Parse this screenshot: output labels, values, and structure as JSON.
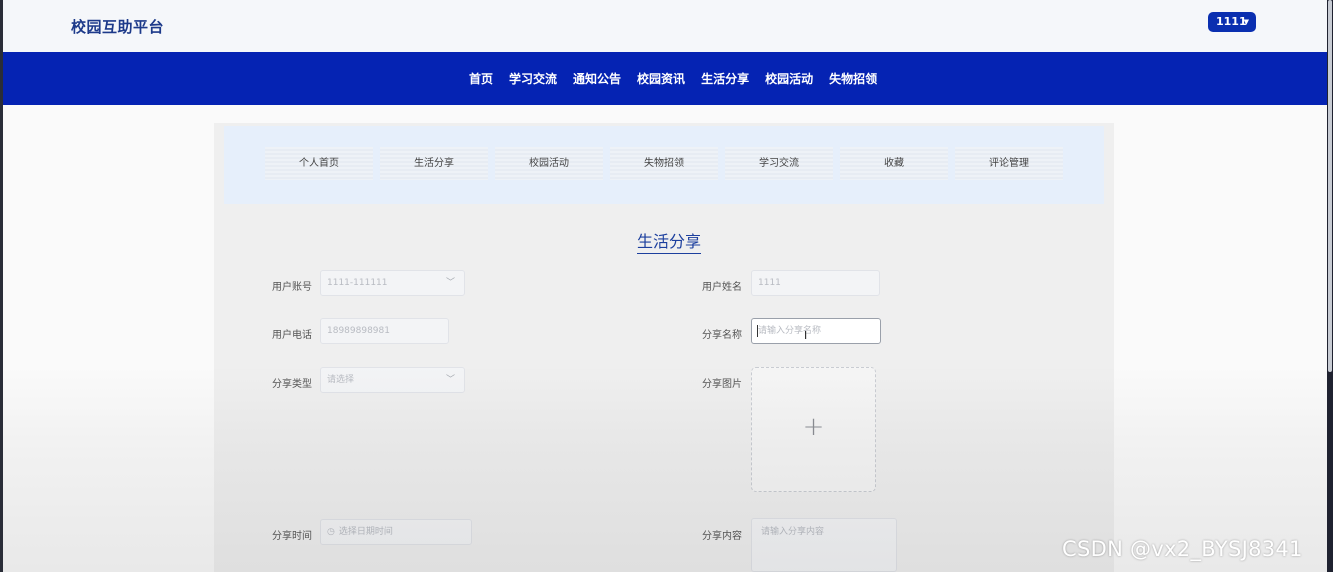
{
  "header": {
    "brand": "校园互助平台",
    "user_label": "1111",
    "caret_icon": "caret-down-icon"
  },
  "nav": {
    "items": [
      "首页",
      "学习交流",
      "通知公告",
      "校园资讯",
      "生活分享",
      "校园活动",
      "失物招领"
    ]
  },
  "subnav": {
    "items": [
      "个人首页",
      "生活分享",
      "校园活动",
      "失物招领",
      "学习交流",
      "收藏",
      "评论管理"
    ]
  },
  "page_title": "生活分享",
  "form": {
    "account": {
      "label": "用户账号",
      "value": "1111-111111"
    },
    "username": {
      "label": "用户姓名",
      "value": "1111"
    },
    "phone": {
      "label": "用户电话",
      "value": "18989898981"
    },
    "share_name": {
      "label": "分享名称",
      "placeholder": "请输入分享名称"
    },
    "share_type": {
      "label": "分享类型",
      "placeholder": "请选择"
    },
    "share_image": {
      "label": "分享图片",
      "upload_icon": "plus-icon"
    },
    "share_time": {
      "label": "分享时间",
      "placeholder": "选择日期时间",
      "icon": "clock-icon"
    },
    "share_content": {
      "label": "分享内容",
      "placeholder": "请输入分享内容"
    }
  },
  "watermark": "CSDN @vx2_BYSJ8341",
  "colors": {
    "navbar": "#0523b3",
    "brand": "#1d3a8a",
    "user_button": "#0a2fb0",
    "accent_title": "#1c3f9e"
  }
}
